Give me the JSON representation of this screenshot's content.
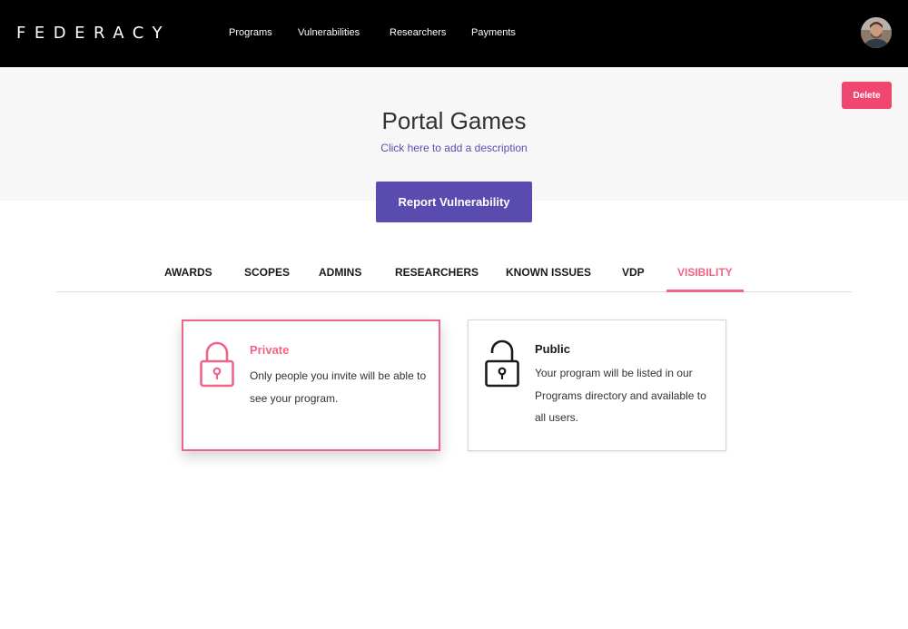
{
  "nav": {
    "logo": "FEDERACY",
    "links": [
      "Programs",
      "Vulnerabilities",
      "Researchers",
      "Payments"
    ]
  },
  "header": {
    "delete_label": "Delete",
    "title": "Portal Games",
    "description_link": "Click here to add a description",
    "report_label": "Report Vulnerability"
  },
  "tabs": [
    "AWARDS",
    "SCOPES",
    "ADMINS",
    "RESEARCHERS",
    "KNOWN ISSUES",
    "VDP",
    "VISIBILITY"
  ],
  "active_tab": "VISIBILITY",
  "visibility": {
    "private": {
      "title": "Private",
      "text": "Only people you invite will be able to see your program.",
      "selected": true
    },
    "public": {
      "title": "Public",
      "text": "Your program will be listed in our Programs directory and available to all users.",
      "selected": false
    }
  },
  "colors": {
    "navbar": "#000000",
    "accent_pink": "#f06488",
    "delete_button": "#f04770",
    "primary_purple": "#5a4caf",
    "header_bg": "#f7f7f7"
  },
  "icons": {
    "private": "lock-closed-icon",
    "public": "lock-open-icon"
  }
}
